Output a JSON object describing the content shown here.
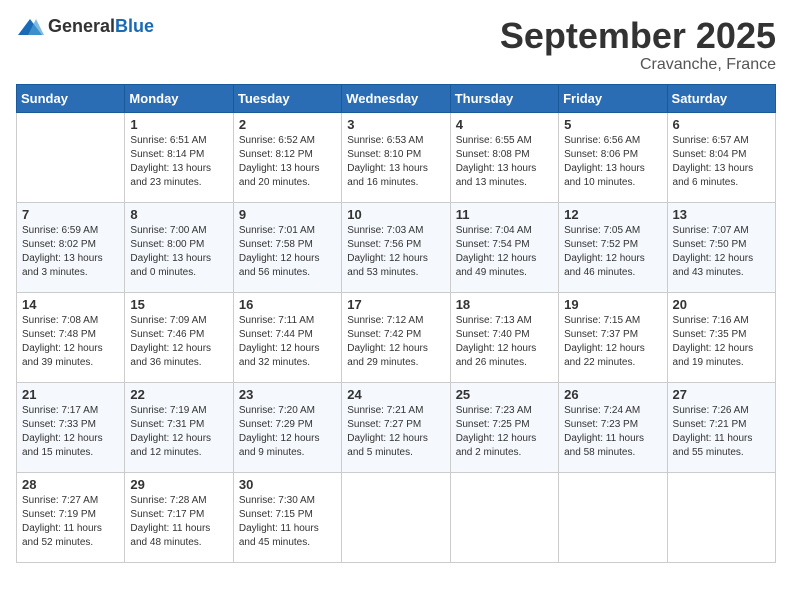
{
  "logo": {
    "general": "General",
    "blue": "Blue"
  },
  "header": {
    "month": "September 2025",
    "location": "Cravanche, France"
  },
  "days_of_week": [
    "Sunday",
    "Monday",
    "Tuesday",
    "Wednesday",
    "Thursday",
    "Friday",
    "Saturday"
  ],
  "weeks": [
    [
      {
        "day": "",
        "sunrise": "",
        "sunset": "",
        "daylight": ""
      },
      {
        "day": "1",
        "sunrise": "Sunrise: 6:51 AM",
        "sunset": "Sunset: 8:14 PM",
        "daylight": "Daylight: 13 hours and 23 minutes."
      },
      {
        "day": "2",
        "sunrise": "Sunrise: 6:52 AM",
        "sunset": "Sunset: 8:12 PM",
        "daylight": "Daylight: 13 hours and 20 minutes."
      },
      {
        "day": "3",
        "sunrise": "Sunrise: 6:53 AM",
        "sunset": "Sunset: 8:10 PM",
        "daylight": "Daylight: 13 hours and 16 minutes."
      },
      {
        "day": "4",
        "sunrise": "Sunrise: 6:55 AM",
        "sunset": "Sunset: 8:08 PM",
        "daylight": "Daylight: 13 hours and 13 minutes."
      },
      {
        "day": "5",
        "sunrise": "Sunrise: 6:56 AM",
        "sunset": "Sunset: 8:06 PM",
        "daylight": "Daylight: 13 hours and 10 minutes."
      },
      {
        "day": "6",
        "sunrise": "Sunrise: 6:57 AM",
        "sunset": "Sunset: 8:04 PM",
        "daylight": "Daylight: 13 hours and 6 minutes."
      }
    ],
    [
      {
        "day": "7",
        "sunrise": "Sunrise: 6:59 AM",
        "sunset": "Sunset: 8:02 PM",
        "daylight": "Daylight: 13 hours and 3 minutes."
      },
      {
        "day": "8",
        "sunrise": "Sunrise: 7:00 AM",
        "sunset": "Sunset: 8:00 PM",
        "daylight": "Daylight: 13 hours and 0 minutes."
      },
      {
        "day": "9",
        "sunrise": "Sunrise: 7:01 AM",
        "sunset": "Sunset: 7:58 PM",
        "daylight": "Daylight: 12 hours and 56 minutes."
      },
      {
        "day": "10",
        "sunrise": "Sunrise: 7:03 AM",
        "sunset": "Sunset: 7:56 PM",
        "daylight": "Daylight: 12 hours and 53 minutes."
      },
      {
        "day": "11",
        "sunrise": "Sunrise: 7:04 AM",
        "sunset": "Sunset: 7:54 PM",
        "daylight": "Daylight: 12 hours and 49 minutes."
      },
      {
        "day": "12",
        "sunrise": "Sunrise: 7:05 AM",
        "sunset": "Sunset: 7:52 PM",
        "daylight": "Daylight: 12 hours and 46 minutes."
      },
      {
        "day": "13",
        "sunrise": "Sunrise: 7:07 AM",
        "sunset": "Sunset: 7:50 PM",
        "daylight": "Daylight: 12 hours and 43 minutes."
      }
    ],
    [
      {
        "day": "14",
        "sunrise": "Sunrise: 7:08 AM",
        "sunset": "Sunset: 7:48 PM",
        "daylight": "Daylight: 12 hours and 39 minutes."
      },
      {
        "day": "15",
        "sunrise": "Sunrise: 7:09 AM",
        "sunset": "Sunset: 7:46 PM",
        "daylight": "Daylight: 12 hours and 36 minutes."
      },
      {
        "day": "16",
        "sunrise": "Sunrise: 7:11 AM",
        "sunset": "Sunset: 7:44 PM",
        "daylight": "Daylight: 12 hours and 32 minutes."
      },
      {
        "day": "17",
        "sunrise": "Sunrise: 7:12 AM",
        "sunset": "Sunset: 7:42 PM",
        "daylight": "Daylight: 12 hours and 29 minutes."
      },
      {
        "day": "18",
        "sunrise": "Sunrise: 7:13 AM",
        "sunset": "Sunset: 7:40 PM",
        "daylight": "Daylight: 12 hours and 26 minutes."
      },
      {
        "day": "19",
        "sunrise": "Sunrise: 7:15 AM",
        "sunset": "Sunset: 7:37 PM",
        "daylight": "Daylight: 12 hours and 22 minutes."
      },
      {
        "day": "20",
        "sunrise": "Sunrise: 7:16 AM",
        "sunset": "Sunset: 7:35 PM",
        "daylight": "Daylight: 12 hours and 19 minutes."
      }
    ],
    [
      {
        "day": "21",
        "sunrise": "Sunrise: 7:17 AM",
        "sunset": "Sunset: 7:33 PM",
        "daylight": "Daylight: 12 hours and 15 minutes."
      },
      {
        "day": "22",
        "sunrise": "Sunrise: 7:19 AM",
        "sunset": "Sunset: 7:31 PM",
        "daylight": "Daylight: 12 hours and 12 minutes."
      },
      {
        "day": "23",
        "sunrise": "Sunrise: 7:20 AM",
        "sunset": "Sunset: 7:29 PM",
        "daylight": "Daylight: 12 hours and 9 minutes."
      },
      {
        "day": "24",
        "sunrise": "Sunrise: 7:21 AM",
        "sunset": "Sunset: 7:27 PM",
        "daylight": "Daylight: 12 hours and 5 minutes."
      },
      {
        "day": "25",
        "sunrise": "Sunrise: 7:23 AM",
        "sunset": "Sunset: 7:25 PM",
        "daylight": "Daylight: 12 hours and 2 minutes."
      },
      {
        "day": "26",
        "sunrise": "Sunrise: 7:24 AM",
        "sunset": "Sunset: 7:23 PM",
        "daylight": "Daylight: 11 hours and 58 minutes."
      },
      {
        "day": "27",
        "sunrise": "Sunrise: 7:26 AM",
        "sunset": "Sunset: 7:21 PM",
        "daylight": "Daylight: 11 hours and 55 minutes."
      }
    ],
    [
      {
        "day": "28",
        "sunrise": "Sunrise: 7:27 AM",
        "sunset": "Sunset: 7:19 PM",
        "daylight": "Daylight: 11 hours and 52 minutes."
      },
      {
        "day": "29",
        "sunrise": "Sunrise: 7:28 AM",
        "sunset": "Sunset: 7:17 PM",
        "daylight": "Daylight: 11 hours and 48 minutes."
      },
      {
        "day": "30",
        "sunrise": "Sunrise: 7:30 AM",
        "sunset": "Sunset: 7:15 PM",
        "daylight": "Daylight: 11 hours and 45 minutes."
      },
      {
        "day": "",
        "sunrise": "",
        "sunset": "",
        "daylight": ""
      },
      {
        "day": "",
        "sunrise": "",
        "sunset": "",
        "daylight": ""
      },
      {
        "day": "",
        "sunrise": "",
        "sunset": "",
        "daylight": ""
      },
      {
        "day": "",
        "sunrise": "",
        "sunset": "",
        "daylight": ""
      }
    ]
  ]
}
